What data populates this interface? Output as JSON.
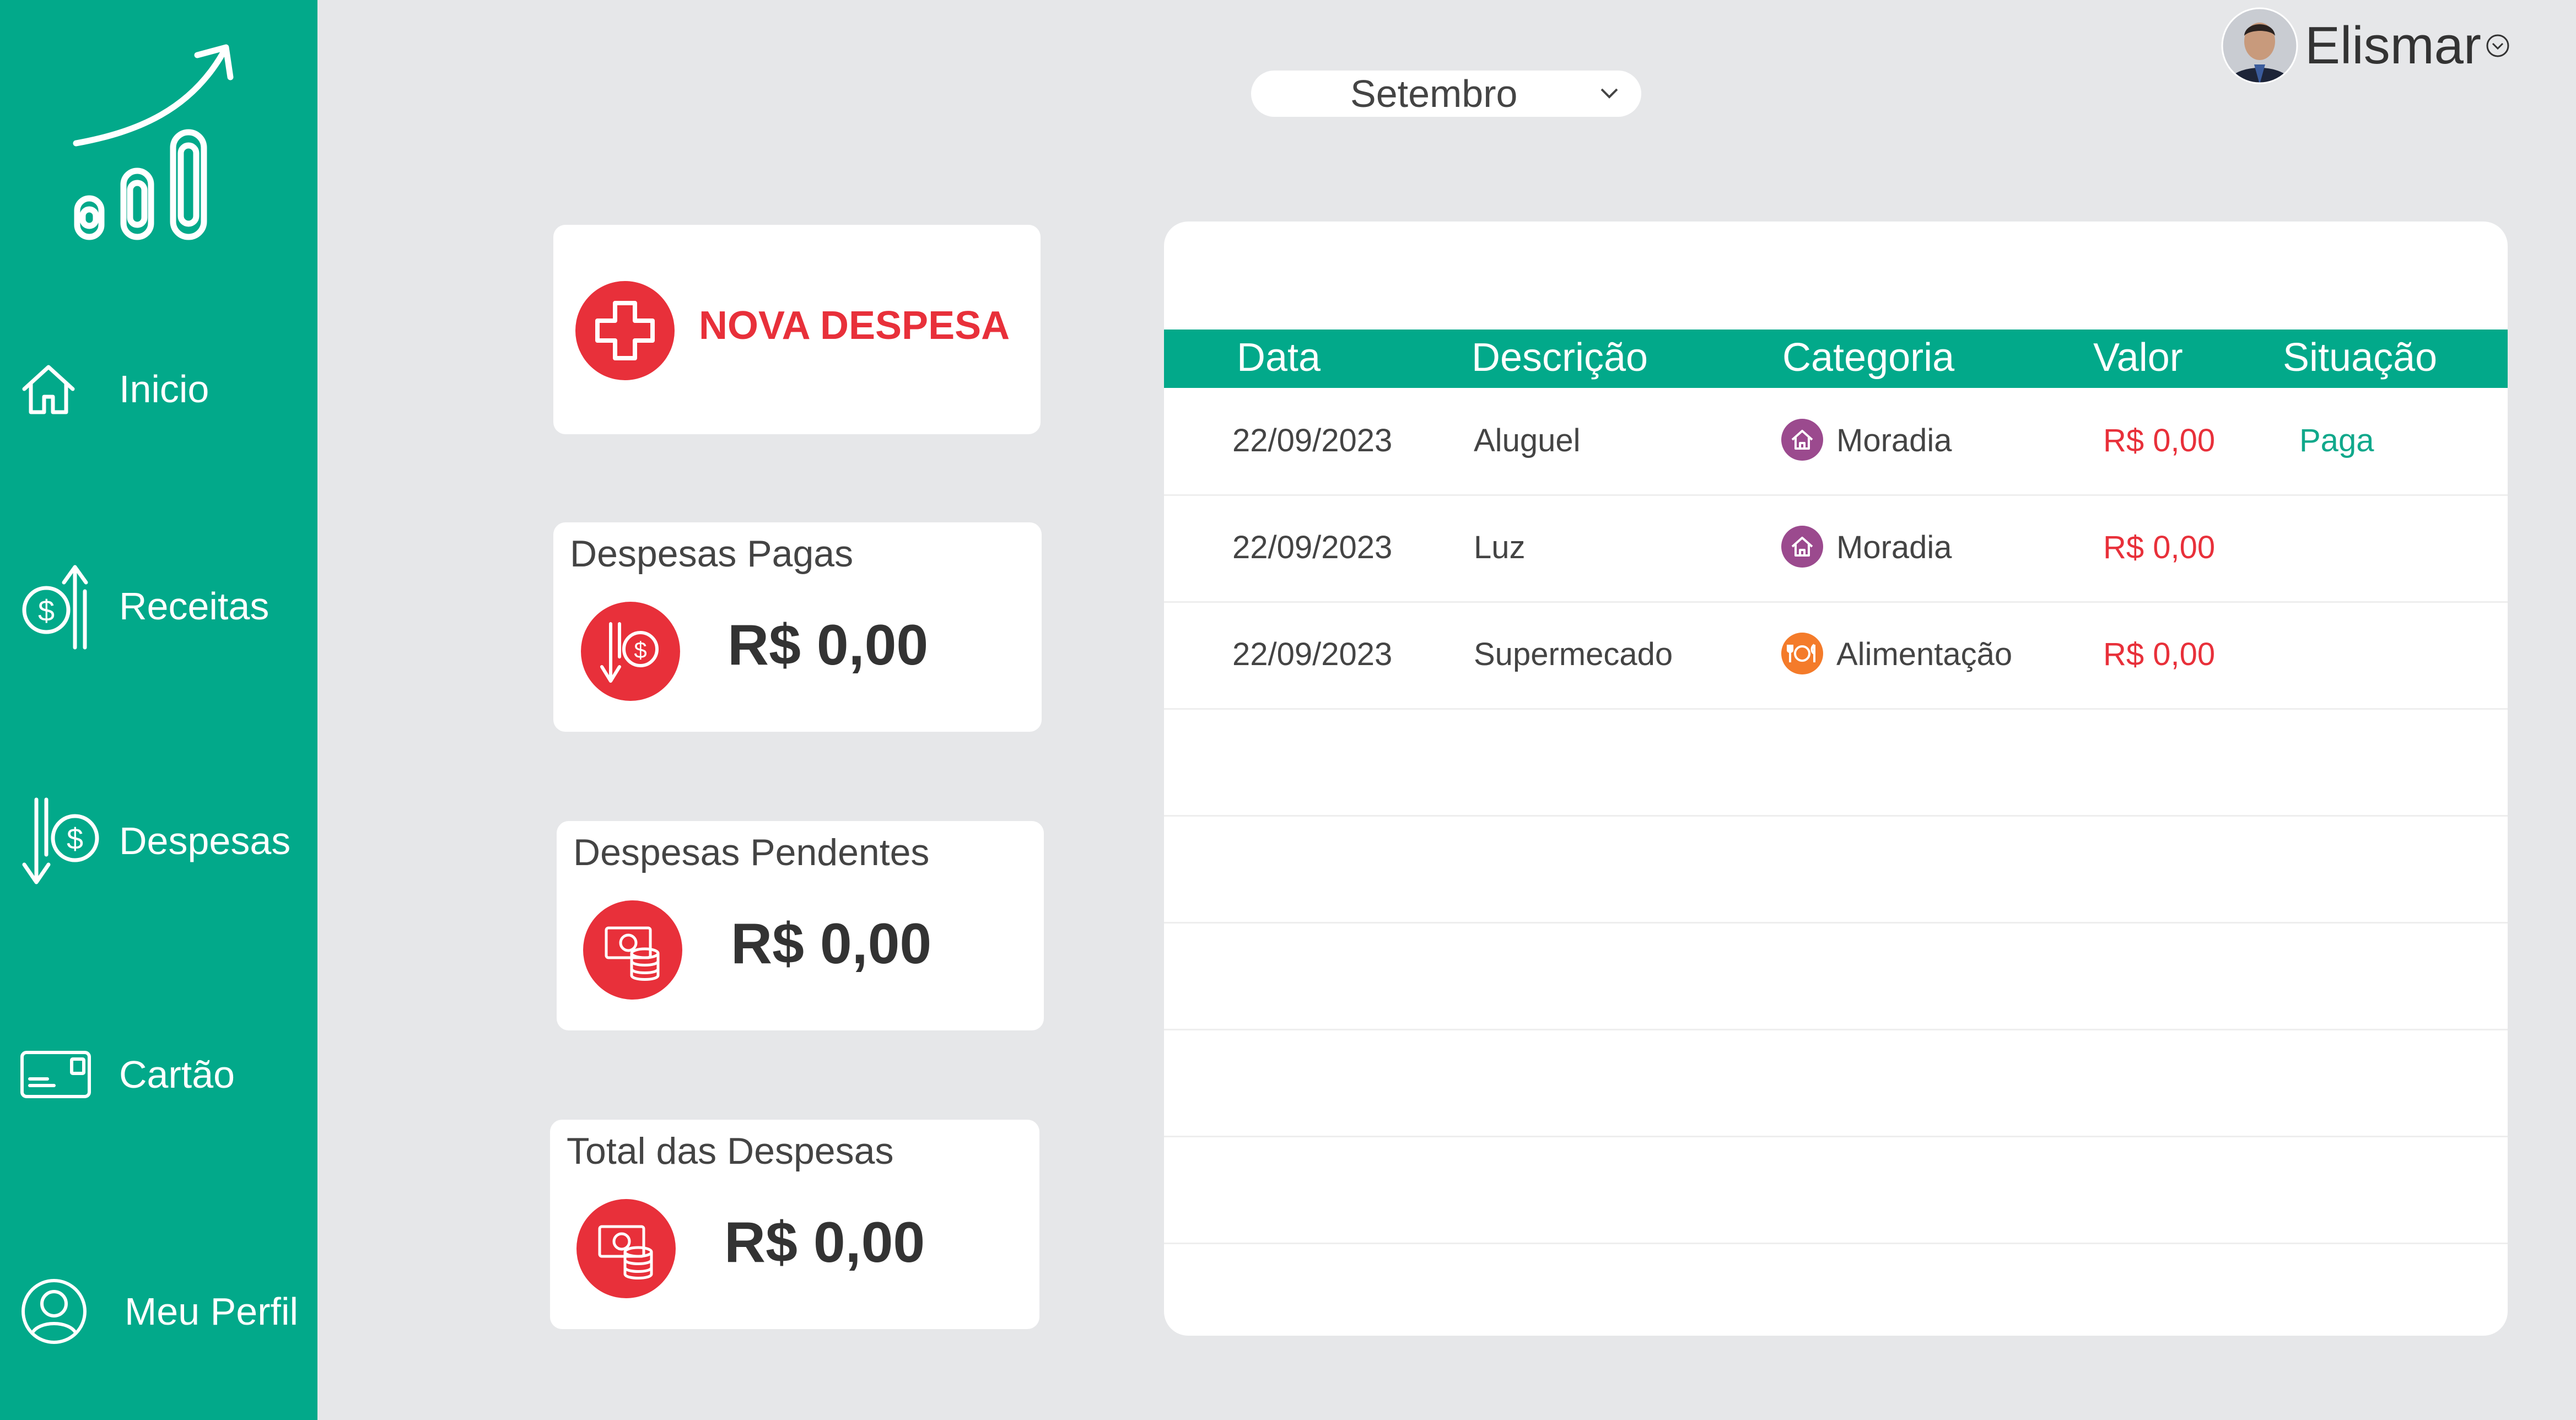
{
  "app": {
    "brand_colors": {
      "primary": "#02a98a",
      "danger": "#e8303a",
      "background": "#e6e7e9",
      "moradia": "#9b4a8e",
      "alimentacao": "#f47b2a"
    }
  },
  "sidebar": {
    "logo_icon": "growth-chart-logo-icon",
    "items": [
      {
        "label": "Inicio",
        "icon": "home-icon"
      },
      {
        "label": "Receitas",
        "icon": "income-icon"
      },
      {
        "label": "Despesas",
        "icon": "expense-icon"
      },
      {
        "label": "Cartão",
        "icon": "card-icon"
      },
      {
        "label": "Meu Perfil",
        "icon": "user-icon"
      }
    ]
  },
  "header": {
    "month": "Setembro",
    "user_name": "Elismar"
  },
  "cards": {
    "new_expense_label": "NOVA DESPESA",
    "paid": {
      "title": "Despesas Pagas",
      "amount": "R$ 0,00"
    },
    "pending": {
      "title": "Despesas Pendentes",
      "amount": "R$ 0,00"
    },
    "total": {
      "title": "Total das Despesas",
      "amount": "R$ 0,00"
    }
  },
  "table": {
    "columns": [
      "Data",
      "Descrição",
      "Categoria",
      "Valor",
      "Situação"
    ],
    "rows": [
      {
        "date": "22/09/2023",
        "description": "Aluguel",
        "category": "Moradia",
        "category_icon": "house-icon",
        "value": "R$ 0,00",
        "status": "Paga"
      },
      {
        "date": "22/09/2023",
        "description": "Luz",
        "category": "Moradia",
        "category_icon": "house-icon",
        "value": "R$ 0,00",
        "status": ""
      },
      {
        "date": "22/09/2023",
        "description": "Supermecado",
        "category": "Alimentação",
        "category_icon": "dining-icon",
        "value": "R$ 0,00",
        "status": ""
      }
    ]
  }
}
